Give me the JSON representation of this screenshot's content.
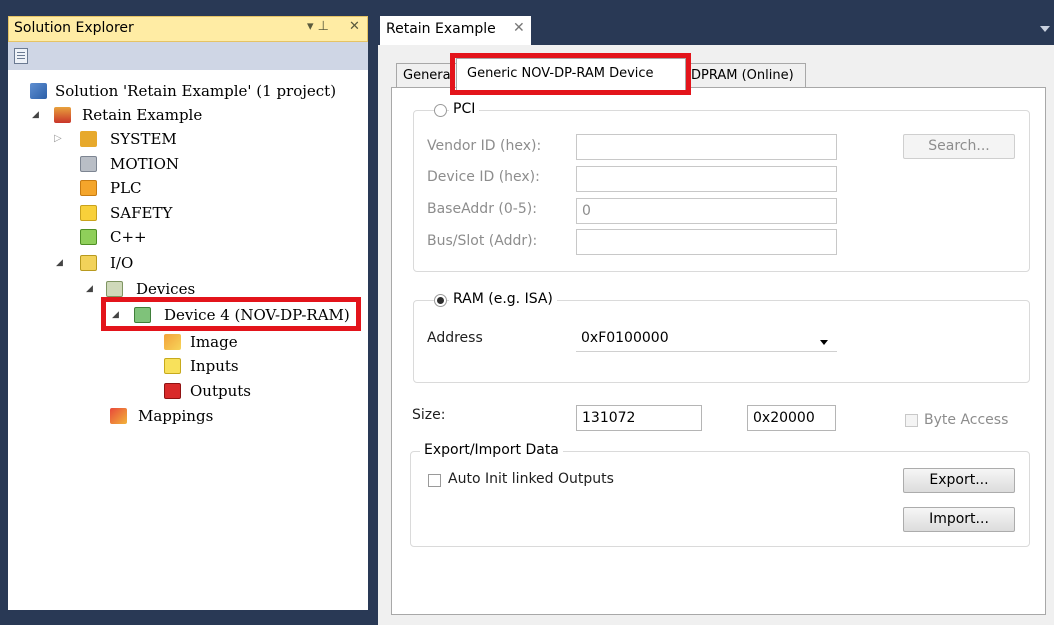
{
  "solution_explorer": {
    "title": "Solution Explorer",
    "pin_glyph": "▾ ⊥",
    "close_glyph": "✕",
    "tree": {
      "solution": "Solution 'Retain Example' (1 project)",
      "project": "Retain Example",
      "system": "SYSTEM",
      "motion": "MOTION",
      "plc": "PLC",
      "safety": "SAFETY",
      "cpp": "C++",
      "io": "I/O",
      "devices": "Devices",
      "device4": "Device 4 (NOV-DP-RAM)",
      "image": "Image",
      "inputs": "Inputs",
      "outputs": "Outputs",
      "mappings": "Mappings"
    }
  },
  "document": {
    "tab_title": "Retain Example",
    "tab_close": "✕"
  },
  "tabs": {
    "general": "General",
    "generic": "Generic NOV-DP-RAM Device",
    "dpram": "DPRAM (Online)"
  },
  "pci": {
    "label": "PCI",
    "selected": false,
    "vendor_label": "Vendor ID (hex):",
    "vendor_value": "",
    "device_label": "Device ID (hex):",
    "device_value": "",
    "baseaddr_label": "BaseAddr (0-5):",
    "baseaddr_value": "0",
    "busslot_label": "Bus/Slot (Addr):",
    "busslot_value": "",
    "search_button": "Search..."
  },
  "ram": {
    "label": "RAM (e.g. ISA)",
    "selected": true,
    "address_label": "Address",
    "address_value": "0xF0100000"
  },
  "size": {
    "label": "Size:",
    "decimal": "131072",
    "hex": "0x20000",
    "byte_access_label": "Byte Access",
    "byte_access_checked": false
  },
  "export_import": {
    "label": "Export/Import Data",
    "auto_init_label": "Auto Init linked Outputs",
    "auto_init_checked": false,
    "export_button": "Export...",
    "import_button": "Import..."
  },
  "colors": {
    "highlight": "#e3141b",
    "frame": "#293955",
    "title_active": "#ffeca4"
  }
}
